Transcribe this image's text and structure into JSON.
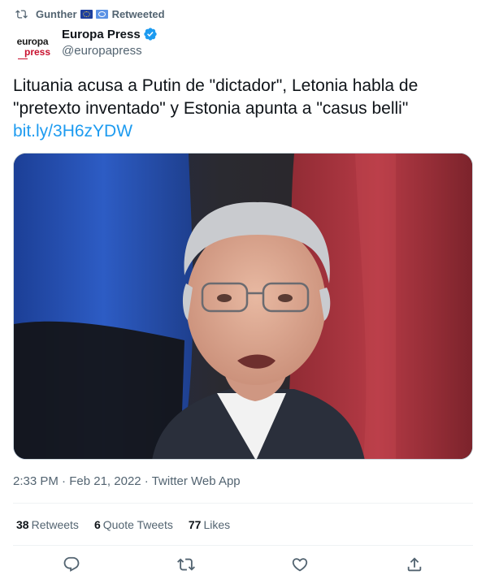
{
  "retweet": {
    "user": "Gunther",
    "flags": [
      "eu-flag",
      "un-flag"
    ],
    "label": "Retweeted"
  },
  "author": {
    "avatar_line1": "europa",
    "avatar_line2": "press",
    "name": "Europa Press",
    "handle": "@europapress",
    "verified": true
  },
  "tweet": {
    "text": "Lituania acusa a Putin de \"dictador\", Letonia habla de \"pretexto inventado\" y Estonia apunta a \"casus belli\"",
    "link": "bit.ly/3H6zYDW"
  },
  "meta": {
    "time": "2:33 PM",
    "date": "Feb 21, 2022",
    "source": "Twitter Web App",
    "separator": "·"
  },
  "stats": [
    {
      "count": "38",
      "label": "Retweets"
    },
    {
      "count": "6",
      "label": "Quote Tweets"
    },
    {
      "count": "77",
      "label": "Likes"
    }
  ],
  "actions": [
    "reply-icon",
    "retweet-icon",
    "like-icon",
    "share-icon"
  ],
  "colors": {
    "link": "#1d9bf0",
    "secondary_text": "#536471",
    "flag_blue": "#2b57b8",
    "flag_red": "#b0333c",
    "brand_red": "#c8102e"
  }
}
